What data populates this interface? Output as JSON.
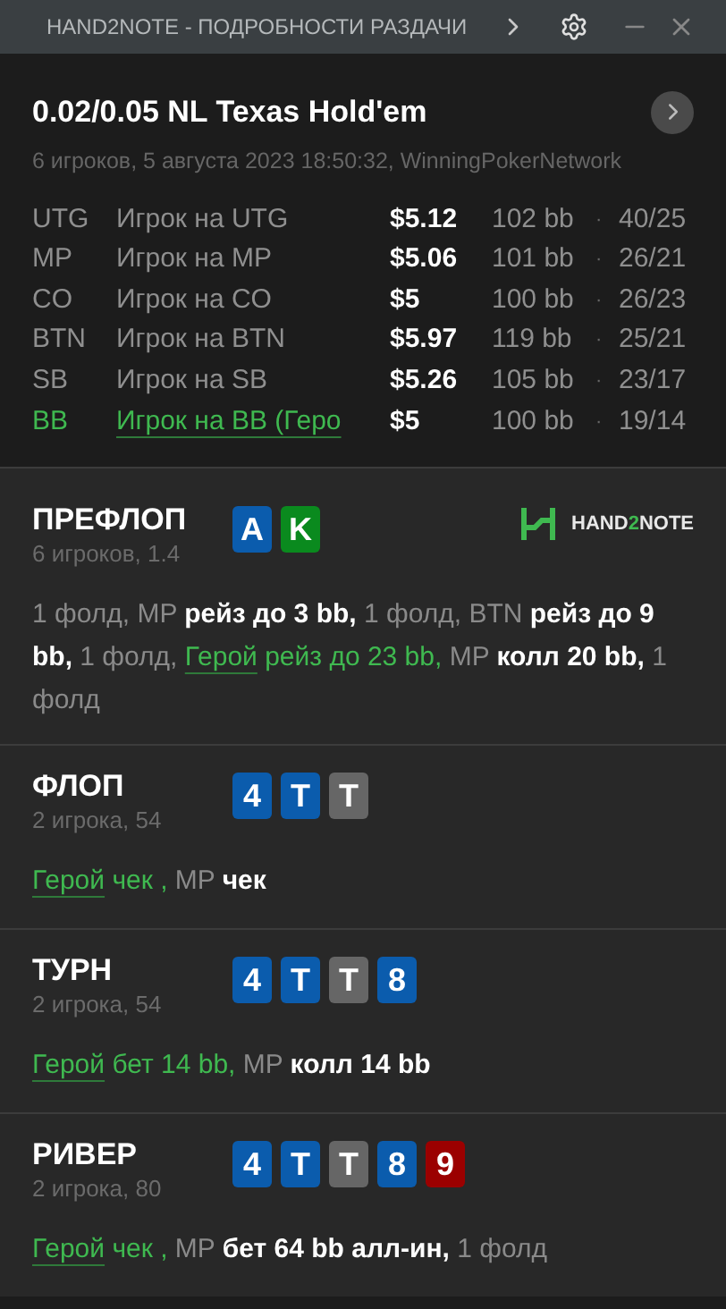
{
  "window": {
    "title": "HAND2NOTE - ПОДРОБНОСТИ РАЗДАЧИ"
  },
  "header": {
    "title": "0.02/0.05 NL Texas Hold'em",
    "subtitle": "6 игроков, 5 августа 2023 18:50:32, WinningPokerNetwork"
  },
  "players": [
    {
      "position": "UTG",
      "name": "Игрок на UTG",
      "stack": "$5.12",
      "bb": "102 bb",
      "separator": "·",
      "stats": "40/25",
      "hero": false
    },
    {
      "position": "MP",
      "name": "Игрок на MP",
      "stack": "$5.06",
      "bb": "101 bb",
      "separator": "·",
      "stats": "26/21",
      "hero": false
    },
    {
      "position": "CO",
      "name": "Игрок на CO",
      "stack": "$5",
      "bb": "100 bb",
      "separator": "·",
      "stats": "26/23",
      "hero": false
    },
    {
      "position": "BTN",
      "name": "Игрок на BTN",
      "stack": "$5.97",
      "bb": "119 bb",
      "separator": "·",
      "stats": "25/21",
      "hero": false
    },
    {
      "position": "SB",
      "name": "Игрок на SB",
      "stack": "$5.26",
      "bb": "105 bb",
      "separator": "·",
      "stats": "23/17",
      "hero": false
    },
    {
      "position": "BB",
      "name": "Игрок на BB (Геро",
      "stack": "$5",
      "bb": "100 bb",
      "separator": "·",
      "stats": "19/14",
      "hero": true
    }
  ],
  "logo": {
    "before": "HAND",
    "accent": "2",
    "after": "NOTE"
  },
  "streets": [
    {
      "name": "ПРЕФЛОП",
      "info": "6 игроков, 1.4",
      "cards": [
        {
          "rank": "A",
          "color": "#0b5cad"
        },
        {
          "rank": "K",
          "color": "#0a8a1e"
        }
      ],
      "actions": [
        {
          "kind": "muted",
          "text": "1 фолд, MP "
        },
        {
          "kind": "action",
          "text": "рейз до 3 bb, "
        },
        {
          "kind": "muted",
          "text": "1 фолд, BTN "
        },
        {
          "kind": "action",
          "text": "рейз до 9 bb, "
        },
        {
          "kind": "muted",
          "text": "1 фолд, "
        },
        {
          "kind": "hero_link",
          "text": "Герой"
        },
        {
          "kind": "hero",
          "text": " рейз до 23 bb, "
        },
        {
          "kind": "muted",
          "text": "MP "
        },
        {
          "kind": "action",
          "text": "колл 20 bb, "
        },
        {
          "kind": "muted",
          "text": "1 фолд"
        }
      ]
    },
    {
      "name": "ФЛОП",
      "info": "2 игрока, 54",
      "cards": [
        {
          "rank": "4",
          "color": "#0b5cad"
        },
        {
          "rank": "T",
          "color": "#0b5cad"
        },
        {
          "rank": "T",
          "color": "#666666"
        }
      ],
      "actions": [
        {
          "kind": "hero_link",
          "text": "Герой"
        },
        {
          "kind": "hero",
          "text": " чек , "
        },
        {
          "kind": "muted",
          "text": "MP "
        },
        {
          "kind": "action",
          "text": "чек"
        }
      ]
    },
    {
      "name": "ТУРН",
      "info": "2 игрока, 54",
      "cards": [
        {
          "rank": "4",
          "color": "#0b5cad"
        },
        {
          "rank": "T",
          "color": "#0b5cad"
        },
        {
          "rank": "T",
          "color": "#666666"
        },
        {
          "rank": "8",
          "color": "#0b5cad"
        }
      ],
      "actions": [
        {
          "kind": "hero_link",
          "text": "Герой"
        },
        {
          "kind": "hero",
          "text": " бет 14 bb, "
        },
        {
          "kind": "muted",
          "text": "MP "
        },
        {
          "kind": "action",
          "text": "колл 14 bb"
        }
      ]
    },
    {
      "name": "РИВЕР",
      "info": "2 игрока, 80",
      "cards": [
        {
          "rank": "4",
          "color": "#0b5cad"
        },
        {
          "rank": "T",
          "color": "#0b5cad"
        },
        {
          "rank": "T",
          "color": "#666666"
        },
        {
          "rank": "8",
          "color": "#0b5cad"
        },
        {
          "rank": "9",
          "color": "#9b0000"
        }
      ],
      "actions": [
        {
          "kind": "hero_link",
          "text": "Герой"
        },
        {
          "kind": "hero",
          "text": " чек , "
        },
        {
          "kind": "muted",
          "text": "MP "
        },
        {
          "kind": "action",
          "text": "бет 64 bb алл-ин, "
        },
        {
          "kind": "muted",
          "text": "1 фолд"
        }
      ]
    }
  ]
}
